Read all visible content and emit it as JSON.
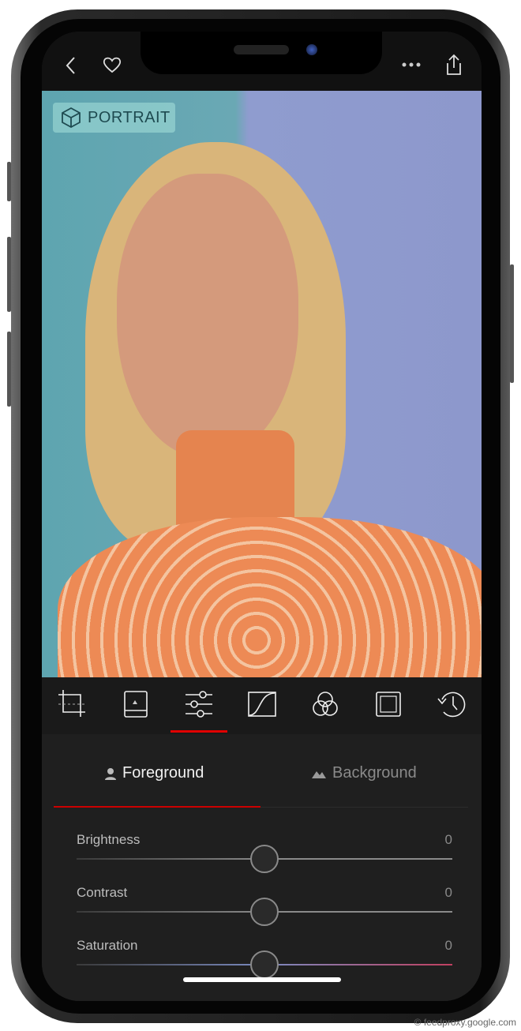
{
  "topbar": {
    "icons": [
      "chevron-left-icon",
      "heart-icon",
      "more-icon",
      "share-icon"
    ]
  },
  "photo": {
    "badge_label": "PORTRAIT",
    "badge_icon": "cube-icon"
  },
  "toolbar": {
    "tools": [
      "crop",
      "image-frame",
      "adjust-sliders",
      "curves",
      "color-mix",
      "vignette",
      "history"
    ],
    "active": "adjust-sliders",
    "accent": "#e00000"
  },
  "tabs": {
    "foreground": "Foreground",
    "background": "Background",
    "active": "foreground"
  },
  "adjustments": [
    {
      "label": "Brightness",
      "value": "0",
      "position": 0.5
    },
    {
      "label": "Contrast",
      "value": "0",
      "position": 0.5
    },
    {
      "label": "Saturation",
      "value": "0",
      "position": 0.5
    }
  ],
  "watermark": "© feedproxy.google.com"
}
